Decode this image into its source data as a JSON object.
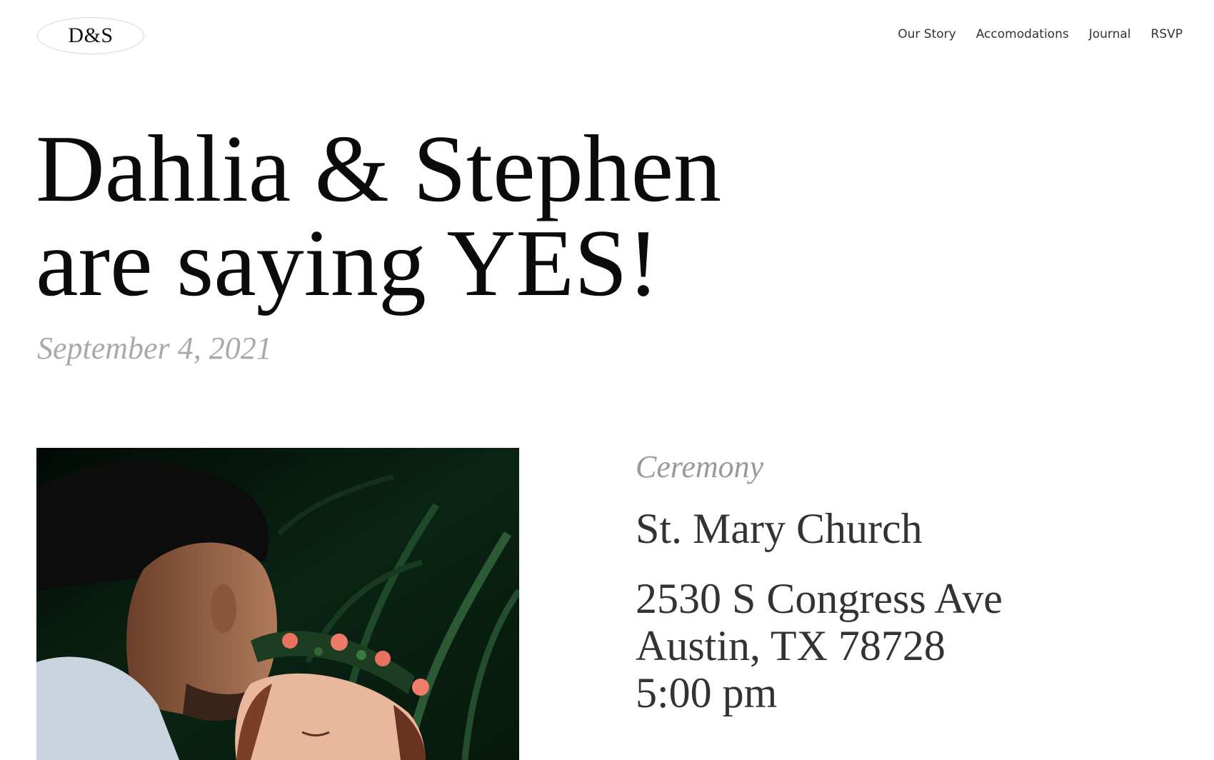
{
  "header": {
    "logo_text": "D&S",
    "nav": [
      {
        "label": "Our Story"
      },
      {
        "label": "Accomodations"
      },
      {
        "label": "Journal"
      },
      {
        "label": "RSVP"
      }
    ]
  },
  "hero": {
    "line1": "Dahlia & Stephen",
    "line2": "are saying YES!",
    "date": "September 4, 2021"
  },
  "ceremony": {
    "label": "Ceremony",
    "venue": "St. Mary Church",
    "address_line1": "2530 S Congress Ave",
    "address_line2": "Austin, TX 78728",
    "time": "5:00 pm"
  },
  "colors": {
    "muted_text": "#a9a9a9",
    "body_text": "#333333",
    "photo_background": "#041208"
  }
}
